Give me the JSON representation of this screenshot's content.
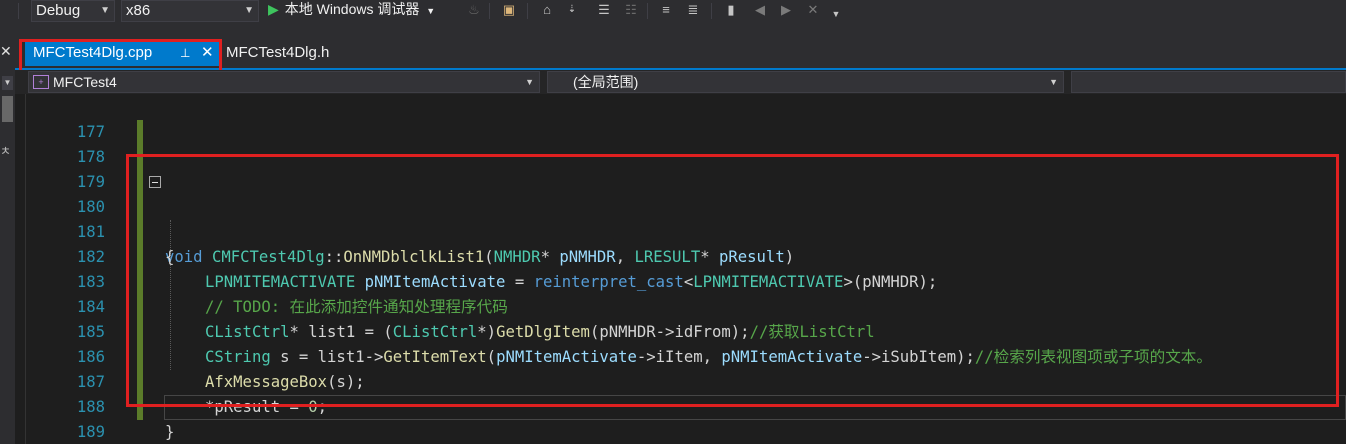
{
  "toolbar": {
    "config": "Debug",
    "platform": "x86",
    "run_label": "本地 Windows 调试器"
  },
  "tabs": {
    "active": "MFCTest4Dlg.cpp",
    "pin_glyph": "⊥",
    "close_glyph": "✕",
    "inactive": "MFCTest4Dlg.h"
  },
  "navbar": {
    "project": "MFCTest4",
    "scope": "(全局范围)"
  },
  "editor": {
    "line_numbers": [
      "177",
      "178",
      "179",
      "180",
      "181",
      "182",
      "183",
      "184",
      "185",
      "186",
      "187",
      "188",
      "189"
    ],
    "lines": {
      "l180": {
        "kw": "void",
        "cls": "CMFCTest4Dlg",
        "sep": "::",
        "fn": "OnNMDblclkList1",
        "p1": "(",
        "t1": "NMHDR",
        "s1": "* ",
        "a1": "pNMHDR",
        "c1": ", ",
        "t2": "LRESULT",
        "s2": "* ",
        "a2": "pResult",
        "p2": ")"
      },
      "l181": {
        "brace": "{"
      },
      "l182": {
        "ty": "LPNMITEMACTIVATE",
        "sp": " ",
        "var": "pNMItemActivate",
        "eq": " = ",
        "kw": "reinterpret_cast",
        "lt": "<",
        "ty2": "LPNMITEMACTIVATE",
        "gt": ">",
        "rest": "(pNMHDR);"
      },
      "l183": {
        "comment": "// TODO: 在此添加控件通知处理程序代码"
      },
      "l184": {
        "ty": "CListCtrl",
        "a": "* list1 = (",
        "ty2": "CListCtrl",
        "b": "*)",
        "fn": "GetDlgItem",
        "c": "(pNMHDR->idFrom);",
        "comment": "//获取ListCtrl"
      },
      "l185": {
        "ty": "CString",
        "a": " s = list1->",
        "fn": "GetItemText",
        "b": "(",
        "v1": "pNMItemActivate",
        "c": "->iItem, ",
        "v2": "pNMItemActivate",
        "d": "->iSubItem);",
        "comment": "//检索列表视图项或子项的文本。"
      },
      "l186": {
        "fn": "AfxMessageBox",
        "rest": "(s);"
      },
      "l187": {
        "a": "*pResult = ",
        "num": "0",
        "end": ";"
      },
      "l188": {
        "brace": "}"
      }
    }
  },
  "colors": {
    "accent": "#007acc",
    "highlight_box": "#e02020",
    "change_bar": "#5b7c2a",
    "line_number": "#2b91af"
  }
}
